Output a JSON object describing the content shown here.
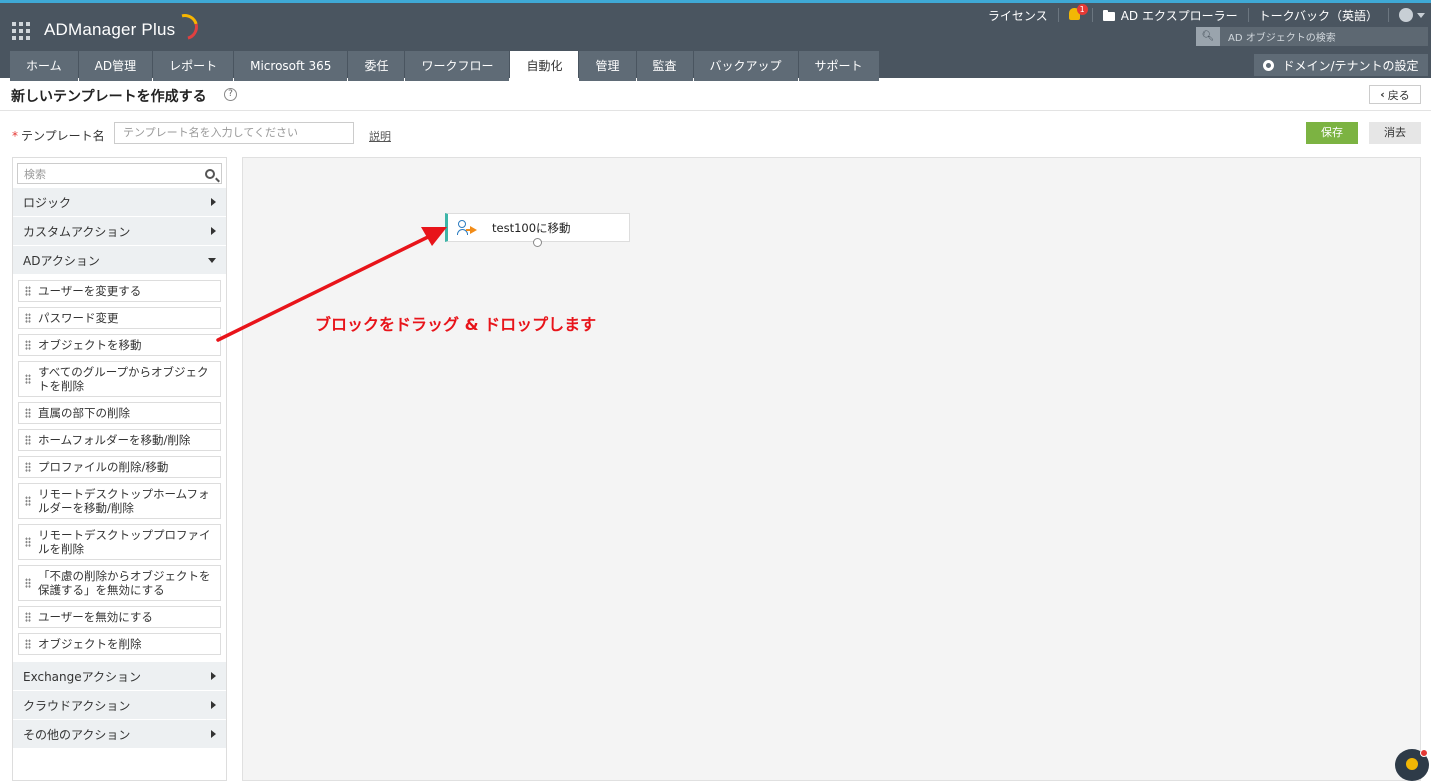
{
  "header": {
    "app_name": "ADManager Plus",
    "license": "ライセンス",
    "notification_count": "1",
    "ad_explorer": "AD エクスプローラー",
    "talkback": "トークバック（英語）",
    "search_placeholder": "AD オブジェクトの検索",
    "domain_button": "ドメイン/テナントの設定",
    "accent_color": "#3fa9d6"
  },
  "tabs": [
    {
      "label": "ホーム"
    },
    {
      "label": "AD管理"
    },
    {
      "label": "レポート"
    },
    {
      "label": "Microsoft 365"
    },
    {
      "label": "委任"
    },
    {
      "label": "ワークフロー"
    },
    {
      "label": "自動化",
      "active": true
    },
    {
      "label": "管理"
    },
    {
      "label": "監査"
    },
    {
      "label": "バックアップ"
    },
    {
      "label": "サポート"
    }
  ],
  "page": {
    "title": "新しいテンプレートを作成する",
    "help": "?",
    "back": "戻る"
  },
  "form": {
    "required_mark": "*",
    "template_label": "テンプレート名",
    "template_placeholder": "テンプレート名を入力してください",
    "description_link": "説明",
    "save": "保存",
    "clear": "消去",
    "save_color": "#7cb342"
  },
  "sidebar": {
    "search_placeholder": "検索",
    "categories_top": [
      {
        "label": "ロジック"
      },
      {
        "label": "カスタムアクション"
      },
      {
        "label": "ADアクション",
        "expanded": true
      }
    ],
    "ad_actions": [
      {
        "label": "ユーザーを変更する"
      },
      {
        "label": "パスワード変更"
      },
      {
        "label": "オブジェクトを移動"
      },
      {
        "label": "すべてのグループからオブジェクトを削除"
      },
      {
        "label": "直属の部下の削除"
      },
      {
        "label": "ホームフォルダーを移動/削除"
      },
      {
        "label": "プロファイルの削除/移動"
      },
      {
        "label": "リモートデスクトップホームフォルダーを移動/削除"
      },
      {
        "label": "リモートデスクトッププロファイルを削除"
      },
      {
        "label": "「不慮の削除からオブジェクトを保護する」を無効にする"
      },
      {
        "label": "ユーザーを無効にする"
      },
      {
        "label": "オブジェクトを削除"
      }
    ],
    "categories_bottom": [
      {
        "label": "Exchangeアクション"
      },
      {
        "label": "クラウドアクション"
      },
      {
        "label": "その他のアクション"
      }
    ]
  },
  "canvas": {
    "block_label": "test100に移動",
    "annotation": "ブロックをドラッグ & ドロップします",
    "annotation_color": "#e8141a"
  }
}
